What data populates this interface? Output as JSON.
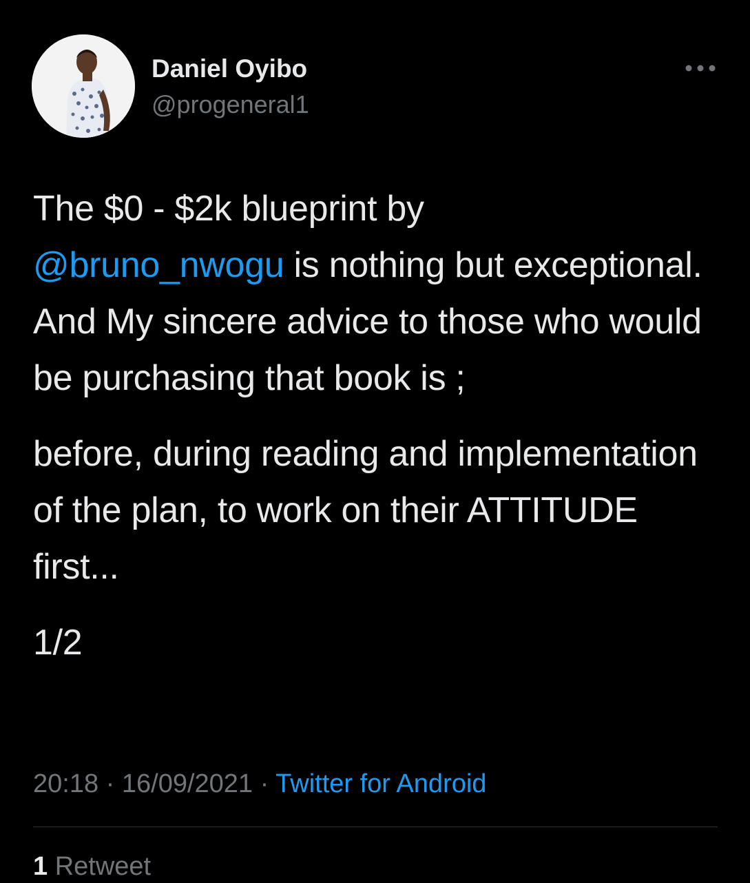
{
  "author": {
    "name": "Daniel Oyibo",
    "handle": "@progeneral1",
    "avatar_icon": "profile-photo"
  },
  "more_icon": "more-horizontal-icon",
  "tweet": {
    "line1_pre": "The $0 - $2k blueprint by",
    "mention": "@bruno_nwogu",
    "line2_post": " is nothing but exceptional. And My sincere advice to those who would be purchasing that book is ;",
    "paragraph2": "before, during reading and implementation of the plan, to work on their ATTITUDE  first...",
    "paragraph3": "1/2"
  },
  "meta": {
    "time": "20:18",
    "separator": " · ",
    "date": "16/09/2021",
    "source": "Twitter for Android"
  },
  "stats": {
    "retweet_count": "1",
    "retweet_label": " Retweet"
  },
  "colors": {
    "background": "#000000",
    "text": "#e7e9ea",
    "muted": "#71767b",
    "accent": "#1d9bf0",
    "divider": "#2f3336"
  }
}
